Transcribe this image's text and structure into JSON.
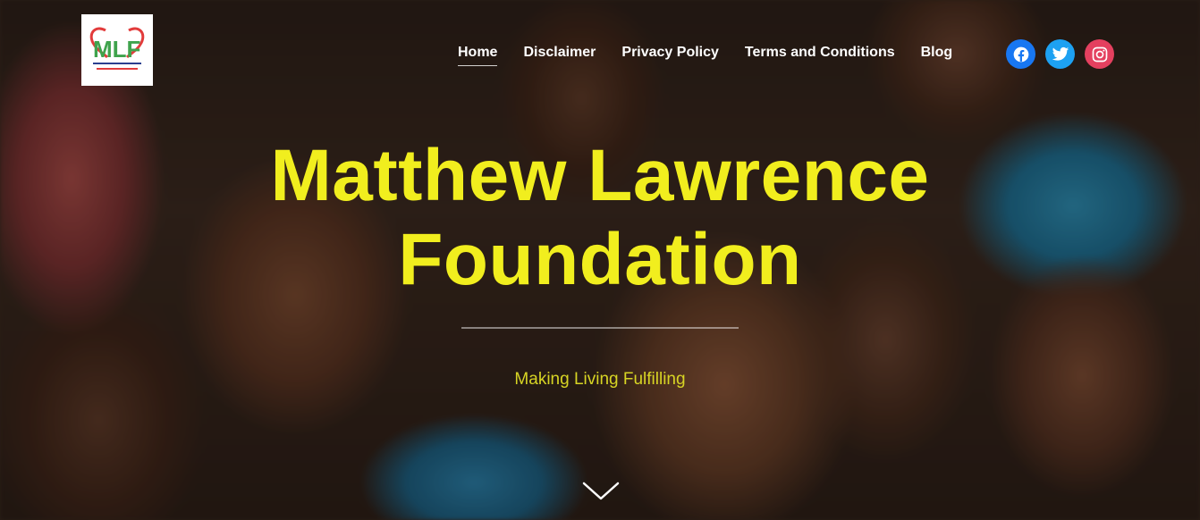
{
  "logo": {
    "text": "MLF",
    "alt": "Matthew Lawrence Foundation logo"
  },
  "nav": {
    "items": [
      {
        "label": "Home",
        "active": true
      },
      {
        "label": "Disclaimer",
        "active": false
      },
      {
        "label": "Privacy Policy",
        "active": false
      },
      {
        "label": "Terms and Conditions",
        "active": false
      },
      {
        "label": "Blog",
        "active": false
      }
    ]
  },
  "social": [
    {
      "name": "facebook-icon",
      "color": "#1877f2"
    },
    {
      "name": "twitter-icon",
      "color": "#1da1f2"
    },
    {
      "name": "instagram-icon",
      "color": "#e4405f"
    }
  ],
  "hero": {
    "title_line1": "Matthew Lawrence",
    "title_line2": "Foundation",
    "tagline": "Making Living Fulfilling"
  },
  "colors": {
    "title": "#f1ee1e",
    "tagline": "#d7d424"
  }
}
